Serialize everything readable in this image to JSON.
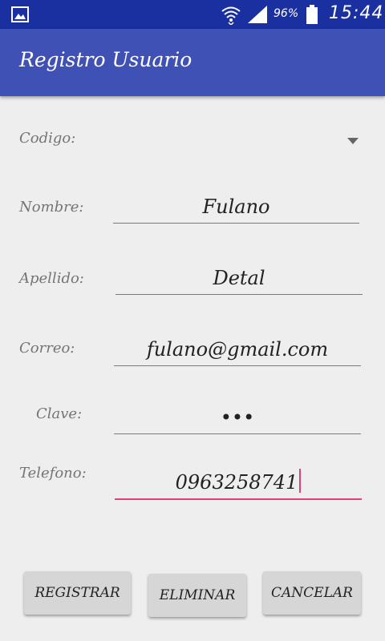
{
  "status_bar": {
    "battery": "96%",
    "time": "15:44",
    "icons": [
      "gallery-icon",
      "wifi-icon",
      "signal-icon",
      "battery-icon"
    ]
  },
  "app_bar": {
    "title": "Registro Usuario"
  },
  "form": {
    "codigo": {
      "label": "Codigo:",
      "value": ""
    },
    "nombre": {
      "label": "Nombre:",
      "value": "Fulano"
    },
    "apellido": {
      "label": "Apellido:",
      "value": "Detal"
    },
    "correo": {
      "label": "Correo:",
      "value": "fulano@gmail.com"
    },
    "clave": {
      "label": "Clave:",
      "value": "•••"
    },
    "telefono": {
      "label": "Telefono:",
      "value": "0963258741"
    }
  },
  "buttons": {
    "registrar": "REGISTRAR",
    "eliminar": "ELIMINAR",
    "cancelar": "CANCELAR"
  },
  "colors": {
    "status_bar": "#1a2fa0",
    "app_bar": "#3f51b5",
    "accent": "#e0407a",
    "background": "#eeeeee"
  }
}
